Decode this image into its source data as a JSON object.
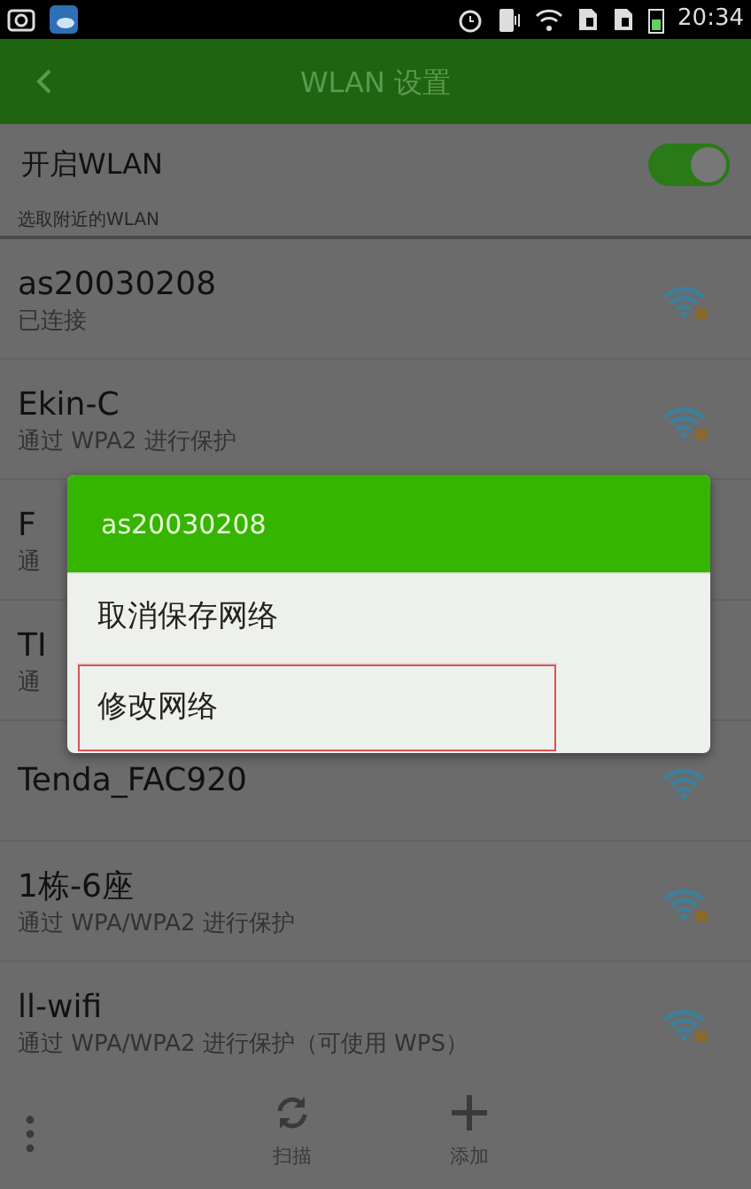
{
  "status_bar": {
    "time": "20:34"
  },
  "app_bar": {
    "title": "WLAN 设置"
  },
  "wlan_toggle": {
    "label": "开启WLAN",
    "on": true
  },
  "section_label": "选取附近的WLAN",
  "networks": [
    {
      "name": "as20030208",
      "status": "已连接",
      "locked": true
    },
    {
      "name": "Ekin-C",
      "status": "通过 WPA2 进行保护",
      "locked": true
    },
    {
      "name": "F",
      "status": "通"
    },
    {
      "name": "TI",
      "status": "通"
    },
    {
      "name": "Tenda_FAC920",
      "locked": false
    },
    {
      "name": "1栋-6座",
      "status": "通过 WPA/WPA2 进行保护",
      "locked": true
    },
    {
      "name": "ll-wifi",
      "status": "通过 WPA/WPA2 进行保护（可使用 WPS）",
      "locked": true
    }
  ],
  "dialog": {
    "title": "as20030208",
    "items": [
      {
        "label": "取消保存网络",
        "highlighted": false
      },
      {
        "label": "修改网络",
        "highlighted": true
      }
    ]
  },
  "toolbar": [
    {
      "kind": "scan",
      "label": "扫描"
    },
    {
      "kind": "add",
      "label": "添加"
    }
  ]
}
